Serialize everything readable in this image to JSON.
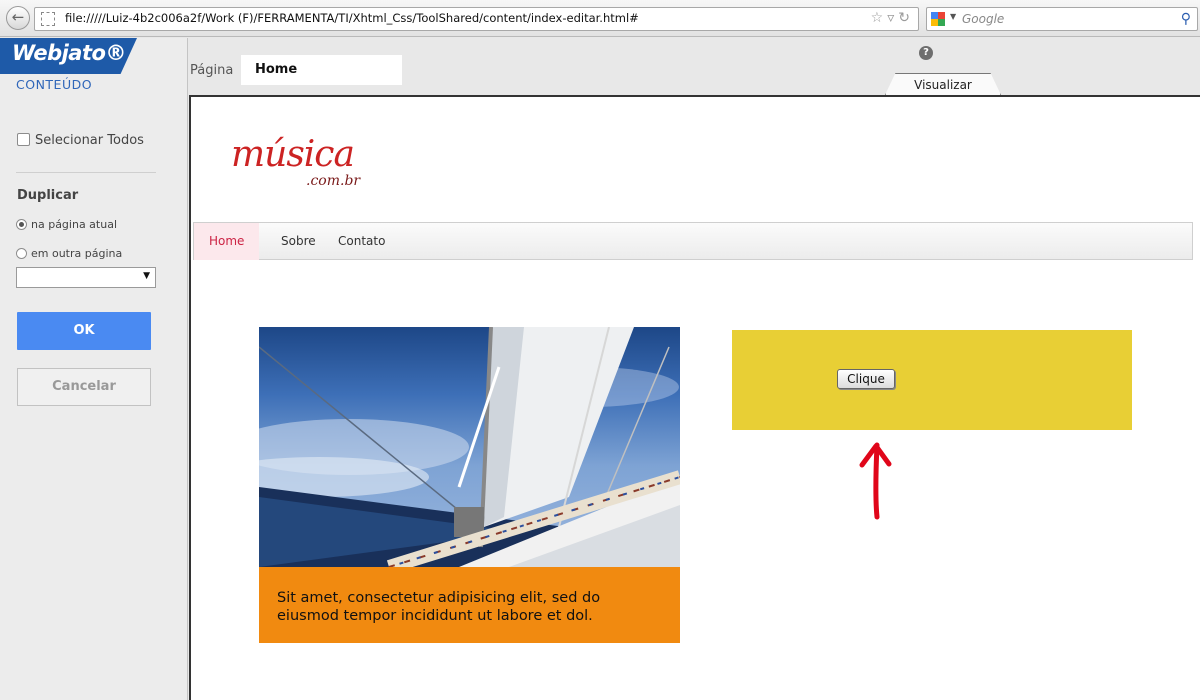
{
  "browser": {
    "url": "file://///Luiz-4b2c006a2f/Work  (F)/FERRAMENTA/TI/Xhtml_Css/ToolShared/content/index-editar.html#",
    "search_placeholder": "Google",
    "back_icon": "back-arrow-icon",
    "bookmark_icon": "star-icon",
    "reload_icon": "reload-icon"
  },
  "sidebar": {
    "logo": "Webjato®",
    "section_title": "CONTEÚDO",
    "select_all_label": "Selecionar Todos",
    "select_all_checked": false,
    "duplicate_title": "Duplicar",
    "radio_current_label": "na página atual",
    "radio_other_label": "em outra página",
    "selected_radio": "na página atual",
    "page_select_value": "",
    "ok_label": "OK",
    "cancel_label": "Cancelar"
  },
  "editor": {
    "page_label": "Página",
    "page_name": "Home",
    "help_icon": "help-icon",
    "view_tab_label": "Visualizar"
  },
  "site": {
    "brand": "música",
    "brand_suffix": ".com.br",
    "nav": [
      "Home",
      "Sobre",
      "Contato"
    ],
    "active_nav": "Home",
    "caption": "Sit amet, consectetur adipisicing elit, sed do eiusmod tempor incididunt ut  labore et dol.",
    "button_label": "Clique",
    "colors": {
      "brand_red": "#cc2323",
      "caption_orange": "#f18a10",
      "yellow_box": "#e8cf35",
      "ok_blue": "#4a8af2",
      "arrow_red": "#e0061a"
    }
  }
}
